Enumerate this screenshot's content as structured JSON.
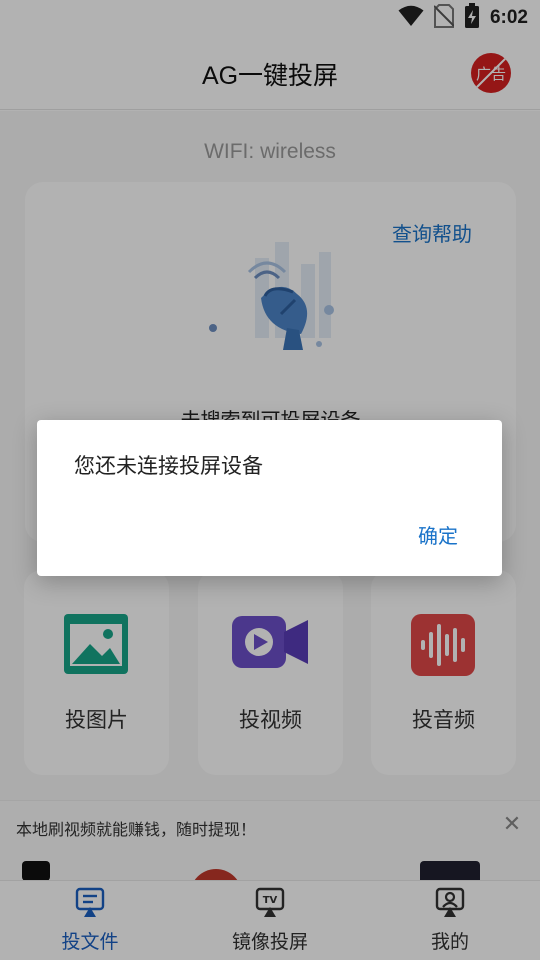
{
  "status_bar": {
    "time": "6:02",
    "icons": [
      "wifi-icon",
      "no-sim-icon",
      "battery-charging-icon"
    ]
  },
  "app_bar": {
    "title": "AG一键投屏",
    "ad_badge_label": "广告",
    "ad_badge_color": "#d62020"
  },
  "main": {
    "wifi_label": "WIFI: wireless",
    "help_link": "查询帮助",
    "no_device_text": "未搜索到可投屏设备",
    "tiles": [
      {
        "label": "投图片",
        "icon": "image-icon",
        "color": "#17a589"
      },
      {
        "label": "投视频",
        "icon": "video-camera-icon",
        "color": "#6c4fc9"
      },
      {
        "label": "投音频",
        "icon": "audio-wave-icon",
        "color": "#e04848"
      }
    ]
  },
  "ad_banner": {
    "text": "本地刷视频就能赚钱，随时提现！",
    "close_icon": "close-icon"
  },
  "bottom_nav": {
    "items": [
      {
        "label": "投文件",
        "icon": "cast-file-icon",
        "active": true
      },
      {
        "label": "镜像投屏",
        "icon": "tv-cast-icon",
        "active": false
      },
      {
        "label": "我的",
        "icon": "profile-icon",
        "active": false
      }
    ],
    "active_color": "#1b5fc1"
  },
  "dialog": {
    "message": "您还未连接投屏设备",
    "confirm_label": "确定"
  },
  "colors": {
    "accent": "#1a73c9",
    "overlay": "rgba(0,0,0,0.30)"
  }
}
